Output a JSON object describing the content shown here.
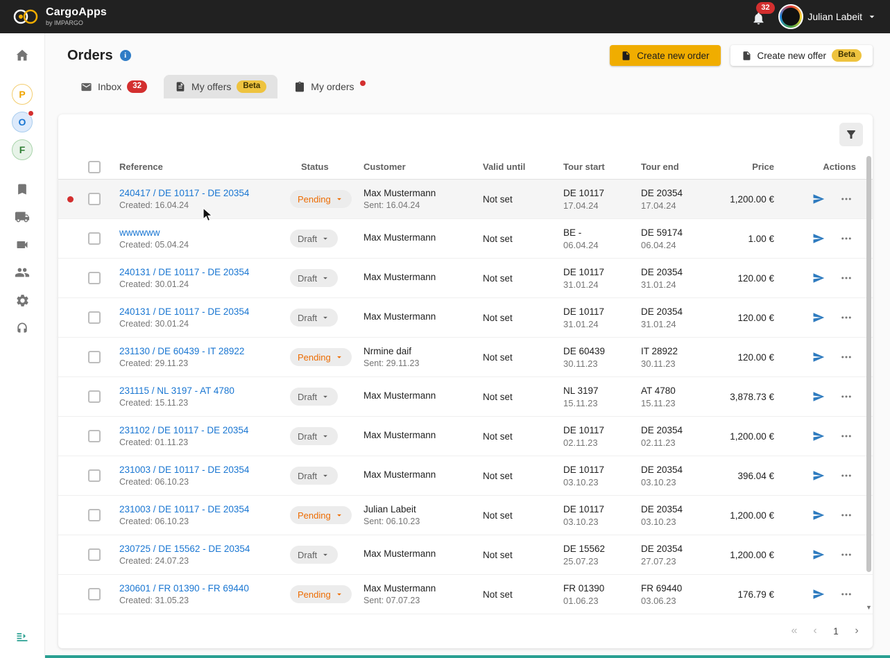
{
  "topbar": {
    "brand": "CargoApps",
    "brand_sub": "by IMPARGO",
    "notification_count": "32",
    "user_name": "Julian Labeit"
  },
  "page": {
    "title": "Orders"
  },
  "actions": {
    "create_order": "Create new order",
    "create_offer": "Create new offer",
    "beta": "Beta"
  },
  "tabs": {
    "inbox": {
      "label": "Inbox",
      "badge": "32"
    },
    "offers": {
      "label": "My offers",
      "beta": "Beta",
      "active": true
    },
    "orders": {
      "label": "My orders",
      "unread": true
    }
  },
  "sidebar": {
    "items": [
      {
        "name": "home"
      },
      {
        "name": "workspace-p",
        "letter": "P",
        "color": "#f0a500"
      },
      {
        "name": "workspace-o",
        "letter": "O",
        "color": "#1976d2",
        "active": true,
        "unread": true
      },
      {
        "name": "workspace-f",
        "letter": "F",
        "color": "#2e7d32"
      },
      {
        "name": "bookmarks"
      },
      {
        "name": "shipments"
      },
      {
        "name": "tracking"
      },
      {
        "name": "contacts"
      },
      {
        "name": "settings"
      },
      {
        "name": "support"
      },
      {
        "name": "collapse-sidebar"
      }
    ]
  },
  "table": {
    "columns": [
      "Reference",
      "Status",
      "Customer",
      "Valid until",
      "Tour start",
      "Tour end",
      "Price",
      "Actions"
    ],
    "rows": [
      {
        "unread": true,
        "highlight": true,
        "ref": "240417 / DE 10117 - DE 20354",
        "created": "Created: 16.04.24",
        "status": "Pending",
        "customer": "Max Mustermann",
        "customer_sub": "Sent: 16.04.24",
        "valid_until": "Not set",
        "tour_start": "DE 10117",
        "tour_start_date": "17.04.24",
        "tour_end": "DE 20354",
        "tour_end_date": "17.04.24",
        "price": "1,200.00 €"
      },
      {
        "ref": "wwwwww",
        "created": "Created: 05.04.24",
        "status": "Draft",
        "customer": "Max Mustermann",
        "valid_until": "Not set",
        "tour_start": "BE -",
        "tour_start_date": "06.04.24",
        "tour_end": "DE 59174",
        "tour_end_date": "06.04.24",
        "price": "1.00 €"
      },
      {
        "ref": "240131 / DE 10117 - DE 20354",
        "created": "Created: 30.01.24",
        "status": "Draft",
        "customer": "Max Mustermann",
        "valid_until": "Not set",
        "tour_start": "DE 10117",
        "tour_start_date": "31.01.24",
        "tour_end": "DE 20354",
        "tour_end_date": "31.01.24",
        "price": "120.00 €"
      },
      {
        "ref": "240131 / DE 10117 - DE 20354",
        "created": "Created: 30.01.24",
        "status": "Draft",
        "customer": "Max Mustermann",
        "valid_until": "Not set",
        "tour_start": "DE 10117",
        "tour_start_date": "31.01.24",
        "tour_end": "DE 20354",
        "tour_end_date": "31.01.24",
        "price": "120.00 €"
      },
      {
        "ref": "231130 / DE 60439 - IT 28922",
        "created": "Created: 29.11.23",
        "status": "Pending",
        "customer": "Nrmine daif",
        "customer_sub": "Sent: 29.11.23",
        "valid_until": "Not set",
        "tour_start": "DE 60439",
        "tour_start_date": "30.11.23",
        "tour_end": "IT 28922",
        "tour_end_date": "30.11.23",
        "price": "120.00 €"
      },
      {
        "ref": "231115 / NL 3197 - AT 4780",
        "created": "Created: 15.11.23",
        "status": "Draft",
        "customer": "Max Mustermann",
        "valid_until": "Not set",
        "tour_start": "NL 3197",
        "tour_start_date": "15.11.23",
        "tour_end": "AT 4780",
        "tour_end_date": "15.11.23",
        "price": "3,878.73 €"
      },
      {
        "ref": "231102 / DE 10117 - DE 20354",
        "created": "Created: 01.11.23",
        "status": "Draft",
        "customer": "Max Mustermann",
        "valid_until": "Not set",
        "tour_start": "DE 10117",
        "tour_start_date": "02.11.23",
        "tour_end": "DE 20354",
        "tour_end_date": "02.11.23",
        "price": "1,200.00 €"
      },
      {
        "ref": "231003 / DE 10117 - DE 20354",
        "created": "Created: 06.10.23",
        "status": "Draft",
        "customer": "Max Mustermann",
        "valid_until": "Not set",
        "tour_start": "DE 10117",
        "tour_start_date": "03.10.23",
        "tour_end": "DE 20354",
        "tour_end_date": "03.10.23",
        "price": "396.04 €"
      },
      {
        "ref": "231003 / DE 10117 - DE 20354",
        "created": "Created: 06.10.23",
        "status": "Pending",
        "customer": "Julian Labeit",
        "customer_sub": "Sent: 06.10.23",
        "valid_until": "Not set",
        "tour_start": "DE 10117",
        "tour_start_date": "03.10.23",
        "tour_end": "DE 20354",
        "tour_end_date": "03.10.23",
        "price": "1,200.00 €"
      },
      {
        "ref": "230725 / DE 15562 - DE 20354",
        "created": "Created: 24.07.23",
        "status": "Draft",
        "customer": "Max Mustermann",
        "valid_until": "Not set",
        "tour_start": "DE 15562",
        "tour_start_date": "25.07.23",
        "tour_end": "DE 20354",
        "tour_end_date": "27.07.23",
        "price": "1,200.00 €"
      },
      {
        "ref": "230601 / FR 01390 - FR 69440",
        "created": "Created: 31.05.23",
        "status": "Pending",
        "customer": "Max Mustermann",
        "customer_sub": "Sent: 07.07.23",
        "valid_until": "Not set",
        "tour_start": "FR 01390",
        "tour_start_date": "01.06.23",
        "tour_end": "FR 69440",
        "tour_end_date": "03.06.23",
        "price": "176.79 €"
      }
    ]
  },
  "pagination": {
    "first": "«",
    "prev": "‹",
    "page": "1",
    "next": "›"
  },
  "colors": {
    "topbar_bg": "#212121",
    "accent_amber": "#f0ad00",
    "badge_red": "#d32f2f",
    "link_blue": "#1976d2",
    "pending_orange": "#ed6c02",
    "draft_gray": "#616161",
    "send_blue": "#2e7bbf",
    "teal_accent": "#2aa092"
  }
}
